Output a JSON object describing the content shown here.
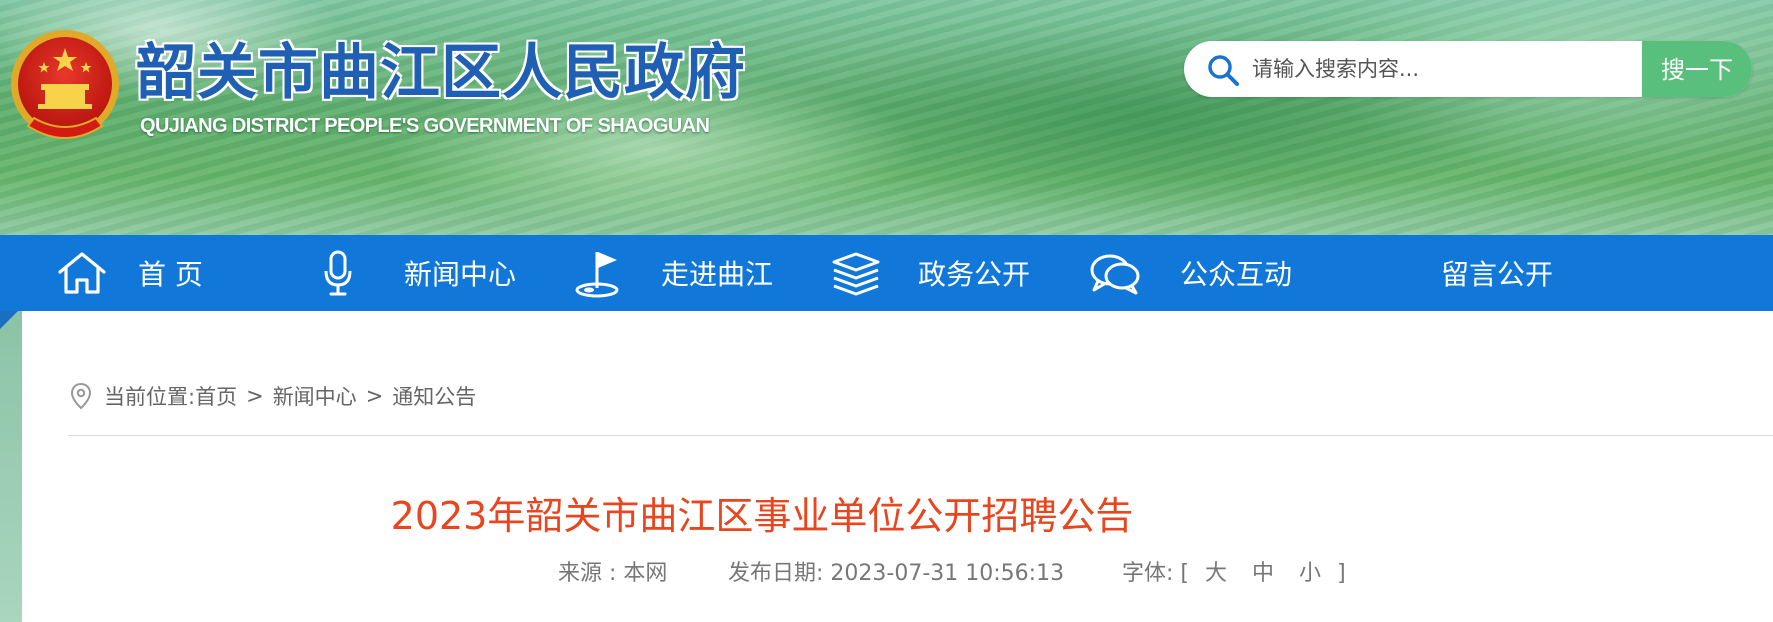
{
  "header": {
    "site_title": "韶关市曲江区人民政府",
    "site_subtitle": "QUJIANG DISTRICT PEOPLE'S GOVERNMENT OF SHAOGUAN",
    "search": {
      "placeholder": "请输入搜索内容...",
      "button_label": "搜一下"
    }
  },
  "nav": {
    "items": [
      {
        "label": "首 页",
        "icon": "home-icon"
      },
      {
        "label": "新闻中心",
        "icon": "microphone-icon"
      },
      {
        "label": "走进曲江",
        "icon": "flag-icon"
      },
      {
        "label": "政务公开",
        "icon": "layers-icon"
      },
      {
        "label": "公众互动",
        "icon": "chat-bubbles-icon"
      },
      {
        "label": "留言公开",
        "icon": ""
      }
    ]
  },
  "breadcrumb": {
    "prefix": "当前位置:",
    "items": [
      "首页",
      "新闻中心",
      "通知公告"
    ],
    "separator": ">"
  },
  "article": {
    "title": "2023年韶关市曲江区事业单位公开招聘公告",
    "source_label": "来源 : 本网",
    "date_label": "发布日期:",
    "date_value": "2023-07-31 10:56:13",
    "font_label": "字体:",
    "font_open": "[",
    "font_large": "大",
    "font_medium": "中",
    "font_small": "小",
    "font_close": "]"
  },
  "colors": {
    "nav_blue": "#1178d9",
    "title_blue": "#1f5fb4",
    "search_green": "#58c07c",
    "article_title_red": "#e8461e"
  }
}
